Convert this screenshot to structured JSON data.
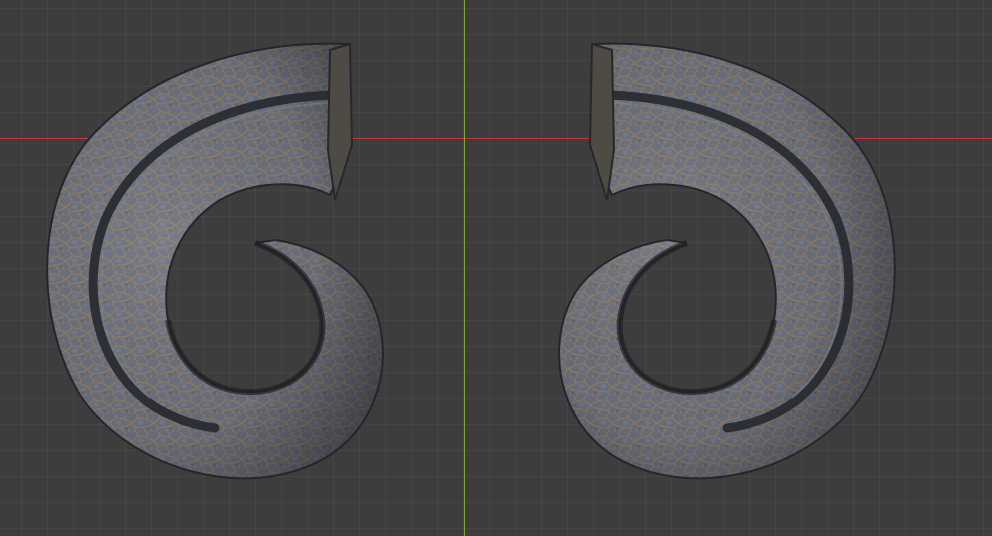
{
  "viewport": {
    "background": "#3d3d3d",
    "grid": true,
    "axis_x_color": "#c43a3a",
    "axis_y_color": "#7ea636"
  },
  "objects": [
    {
      "name": "horn-left",
      "material": "cracked-stone",
      "base_color": "#5f6470",
      "crack_color": "#8a7a60",
      "shadow_color": "#2e3036"
    },
    {
      "name": "horn-right",
      "material": "cracked-stone",
      "base_color": "#5f6470",
      "crack_color": "#8a7a60",
      "shadow_color": "#2e3036"
    }
  ]
}
